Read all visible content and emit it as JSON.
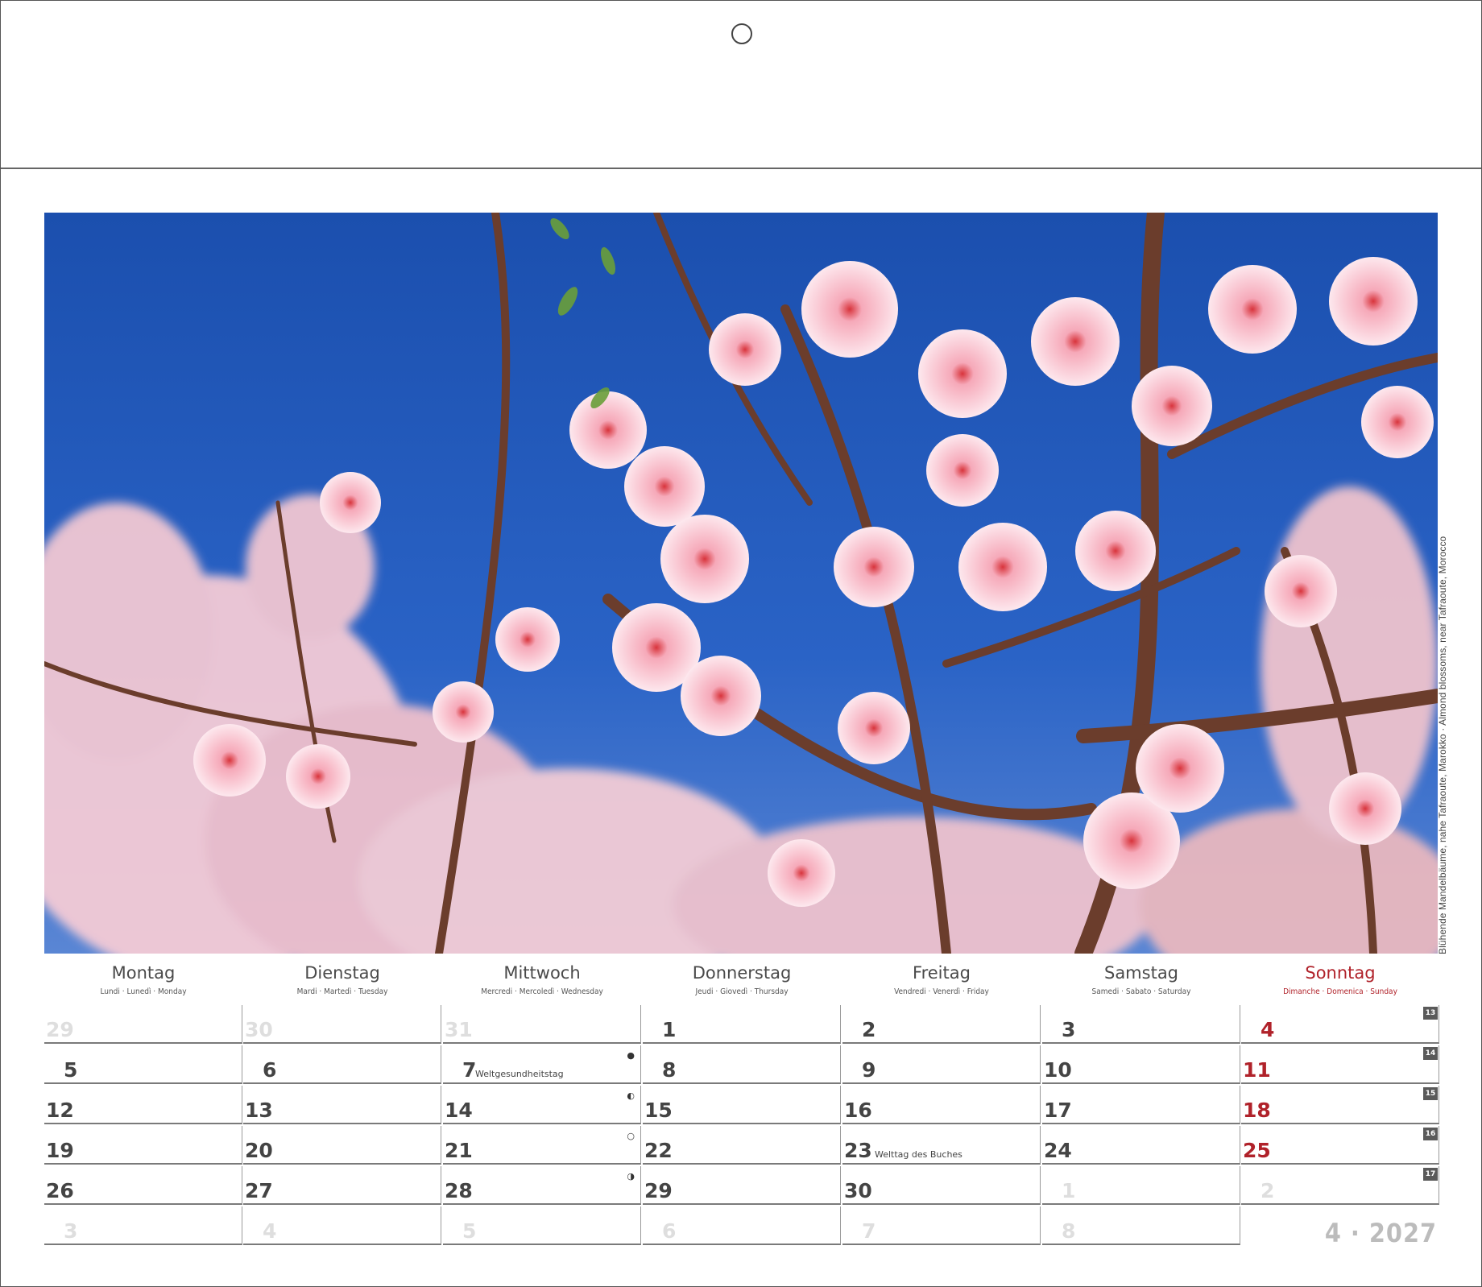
{
  "photo": {
    "caption": "Blühende Mandelbäume, nahe Tafraoute, Marokko · Almond blossoms, near Tafraoute, Morocco"
  },
  "weekdays": [
    {
      "name": "Montag",
      "sub": "Lundi · Lunedì · Monday"
    },
    {
      "name": "Dienstag",
      "sub": "Mardi · Martedì · Tuesday"
    },
    {
      "name": "Mittwoch",
      "sub": "Mercredi · Mercoledì · Wednesday"
    },
    {
      "name": "Donnerstag",
      "sub": "Jeudi · Giovedì · Thursday"
    },
    {
      "name": "Freitag",
      "sub": "Vendredi · Venerdì · Friday"
    },
    {
      "name": "Samstag",
      "sub": "Samedi · Sabato · Saturday"
    },
    {
      "name": "Sonntag",
      "sub": "Dimanche · Domenica · Sunday"
    }
  ],
  "weeks": [
    {
      "kw": "13",
      "days": [
        "29",
        "30",
        "31",
        "1",
        "2",
        "3",
        "4"
      ]
    },
    {
      "kw": "14",
      "days": [
        "5",
        "6",
        "7",
        "8",
        "9",
        "10",
        "11"
      ]
    },
    {
      "kw": "15",
      "days": [
        "12",
        "13",
        "14",
        "15",
        "16",
        "17",
        "18"
      ]
    },
    {
      "kw": "16",
      "days": [
        "19",
        "20",
        "21",
        "22",
        "23",
        "24",
        "25"
      ]
    },
    {
      "kw": "17",
      "days": [
        "26",
        "27",
        "28",
        "29",
        "30",
        "1",
        "2"
      ]
    },
    {
      "kw": "",
      "days": [
        "3",
        "4",
        "5",
        "6",
        "7",
        "8"
      ]
    }
  ],
  "holidays": {
    "apr7": "Weltgesundheitstag",
    "apr23": "Welttag des Buches"
  },
  "moon_phases": {
    "apr7": "●",
    "apr14": "◐",
    "apr21": "○",
    "apr28": "◑"
  },
  "month_year": "4 · 2027",
  "colors": {
    "sunday": "#b0222a",
    "text": "#444444",
    "dim_days": "#dedede",
    "sky": "#1f58b8",
    "blossom": "#f3c2cf"
  }
}
